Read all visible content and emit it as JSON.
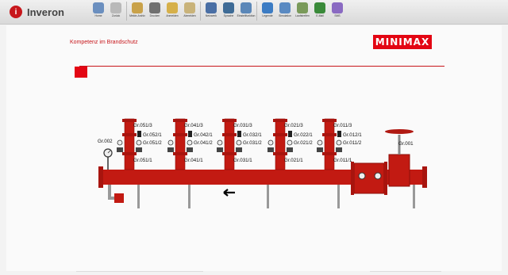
{
  "app": {
    "name": "Inveron"
  },
  "toolbar": {
    "items": [
      {
        "label": "Home",
        "icon": "home-icon",
        "color": "#6b8fbf"
      },
      {
        "label": "Zurück",
        "icon": "back-icon",
        "color": "#b9b9b9"
      },
      {
        "label": "Melde-Archiv",
        "icon": "archive-icon",
        "color": "#c9a24a"
      },
      {
        "label": "Drucken",
        "icon": "printer-icon",
        "color": "#707070"
      },
      {
        "label": "Anmelden",
        "icon": "login-icon",
        "color": "#d6b04a"
      },
      {
        "label": "Abmelden",
        "icon": "logout-icon",
        "color": "#c9b37a"
      },
      {
        "label": "Netzwerk",
        "icon": "network-icon",
        "color": "#4a6fa5"
      },
      {
        "label": "Sprache",
        "icon": "globe-icon",
        "color": "#3e6b96"
      },
      {
        "label": "Einstellfunktion",
        "icon": "settings-icon",
        "color": "#5b87b8"
      },
      {
        "label": "Legende",
        "icon": "info-icon",
        "color": "#3c7cc4"
      },
      {
        "label": "Simulation",
        "icon": "simulation-icon",
        "color": "#5a8ac2"
      },
      {
        "label": "Laufstreifen",
        "icon": "strip-icon",
        "color": "#7a9a5a"
      },
      {
        "label": "E-Mail",
        "icon": "email-icon",
        "color": "#3a8a3a"
      },
      {
        "label": "SMS",
        "icon": "sms-icon",
        "color": "#8a6ac2"
      }
    ]
  },
  "header": {
    "slogan": "Kompetenz im Brandschutz",
    "logo_text": "MINIMAX",
    "accent_color": "#e30613"
  },
  "groups": [
    {
      "top": "Gr.051/3",
      "mid_right": "Gr.052/1",
      "mid": "Gr.051/2",
      "bottom": "Gr.051/1"
    },
    {
      "top": "Gr.041/3",
      "mid_right": "Gr.042/1",
      "mid": "Gr.041/2",
      "bottom": "Gr.041/1"
    },
    {
      "top": "Gr.031/3",
      "mid_right": "Gr.032/1",
      "mid": "Gr.031/2",
      "bottom": "Gr.031/1"
    },
    {
      "top": "Gr.021/3",
      "mid_right": "Gr.022/1",
      "mid": "Gr.021/2",
      "bottom": "Gr.021/1"
    },
    {
      "top": "Gr.011/3",
      "mid_right": "Gr.012/1",
      "mid": "Gr.011/2",
      "bottom": "Gr.011/1"
    }
  ],
  "labels": {
    "left_gauge": "Gr.002",
    "main_valve": "Gr.001"
  }
}
